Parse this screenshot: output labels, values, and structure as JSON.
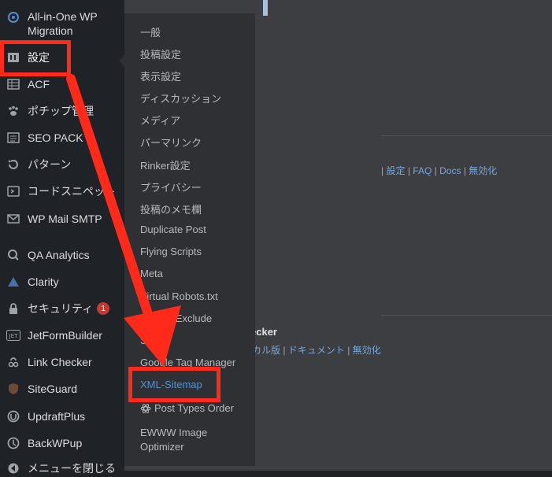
{
  "sidebar": {
    "items": [
      {
        "label": "All-in-One WP Migration",
        "icon": "migration-icon"
      },
      {
        "label": "設定",
        "icon": "settings-icon"
      },
      {
        "label": "ACF",
        "icon": "acf-icon"
      },
      {
        "label": "ポチップ管理",
        "icon": "paw-icon"
      },
      {
        "label": "SEO PACK",
        "icon": "seo-pack-icon"
      },
      {
        "label": "パターン",
        "icon": "patterns-icon"
      },
      {
        "label": "コードスニペット",
        "icon": "code-snippets-icon"
      },
      {
        "label": "WP Mail SMTP",
        "icon": "mail-icon"
      },
      {
        "label": "QA Analytics",
        "icon": "analytics-icon"
      },
      {
        "label": "Clarity",
        "icon": "clarity-icon"
      },
      {
        "label": "セキュリティ",
        "icon": "lock-icon",
        "badge": "1"
      },
      {
        "label": "JetFormBuilder",
        "icon": "jetform-icon"
      },
      {
        "label": "Link Checker",
        "icon": "link-checker-icon"
      },
      {
        "label": "SiteGuard",
        "icon": "shield-icon"
      },
      {
        "label": "UpdraftPlus",
        "icon": "updraft-icon"
      },
      {
        "label": "BackWPup",
        "icon": "backwpup-icon"
      },
      {
        "label": "メニューを閉じる",
        "icon": "collapse-icon"
      }
    ]
  },
  "submenu": {
    "items": [
      {
        "label": "一般"
      },
      {
        "label": "投稿設定"
      },
      {
        "label": "表示設定"
      },
      {
        "label": "ディスカッション"
      },
      {
        "label": "メディア"
      },
      {
        "label": "パーマリンク"
      },
      {
        "label": "Rinker設定"
      },
      {
        "label": "プライバシー"
      },
      {
        "label": "投稿のメモ欄"
      },
      {
        "label": "Duplicate Post"
      },
      {
        "label": "Flying Scripts"
      },
      {
        "label": "Meta"
      },
      {
        "label": "Virtual Robots.txt"
      },
      {
        "label": "Search Exclude"
      },
      {
        "label": "SEO"
      },
      {
        "label": "Google Tag Manager"
      },
      {
        "label": "XML-Sitemap"
      },
      {
        "label": "Post Types Order"
      },
      {
        "label": "EWWW Image Optimizer"
      }
    ]
  },
  "content": {
    "row1_links": [
      "設定",
      "FAQ",
      "Docs",
      "無効化"
    ],
    "row2_name": "ecker",
    "row2_links": [
      "カル版",
      "ドキュメント",
      "無効化"
    ],
    "separator": "|"
  },
  "colors": {
    "annotation_red": "#ff2a1a",
    "link_blue": "#7aa7d8",
    "highlight_blue": "#4f93d6"
  }
}
